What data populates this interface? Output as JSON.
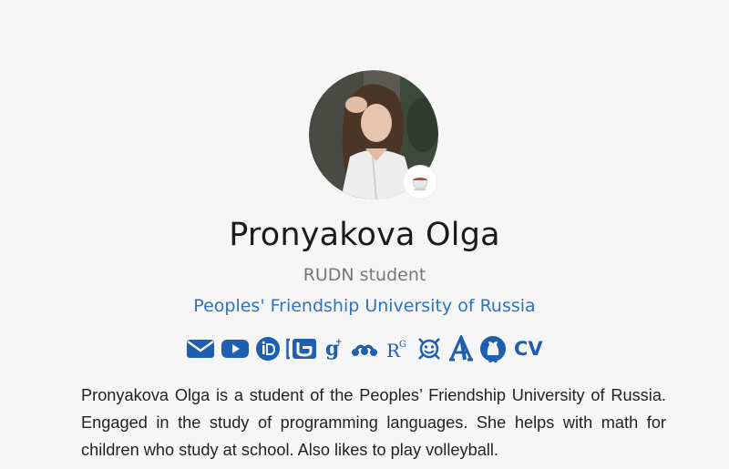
{
  "profile": {
    "name": "Pronyakova Olga",
    "role": "RUDN student",
    "organization": "Peoples' Friendship University of Russia",
    "status_emoji": "tea-cup",
    "bio": "Pronyakova Olga is a student of the Peoples’ Friendship University of Russia. Engaged in the study of programming languages. She helps with math for children who study at school. Also likes to play volleyball."
  },
  "social_links": [
    {
      "icon": "envelope-icon"
    },
    {
      "icon": "youtube-icon"
    },
    {
      "icon": "orcid-icon"
    },
    {
      "icon": "scopus-icon"
    },
    {
      "icon": "google-scholar-icon"
    },
    {
      "icon": "mendeley-icon"
    },
    {
      "icon": "researchgate-icon"
    },
    {
      "icon": "publons-icon"
    },
    {
      "icon": "academia-icon"
    },
    {
      "icon": "github-icon"
    },
    {
      "label": "CV"
    }
  ],
  "colors": {
    "accent": "#1f5fb0",
    "link": "#2f72bf",
    "background": "#f6f6f6"
  }
}
